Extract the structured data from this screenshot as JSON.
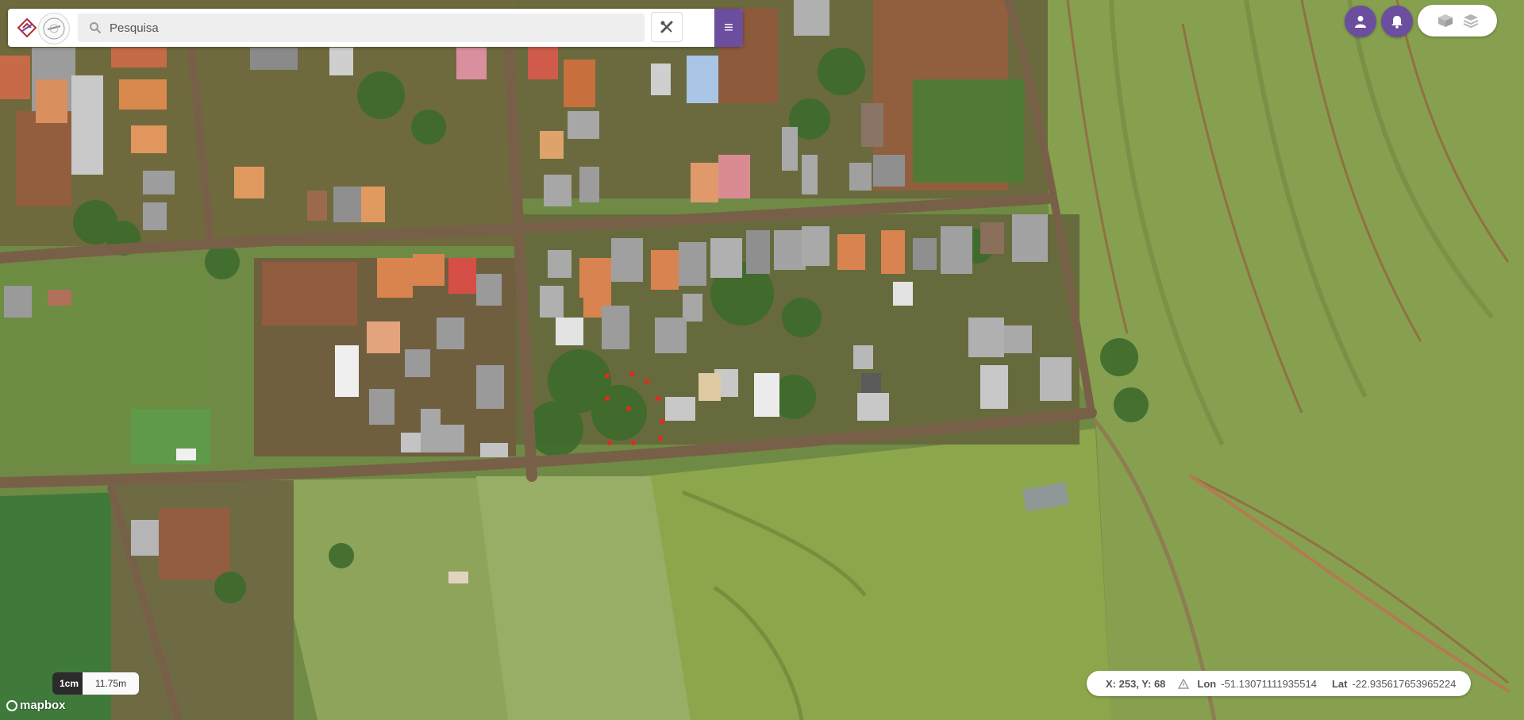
{
  "search": {
    "placeholder": "Pesquisa"
  },
  "toolbar": {
    "tools_icon": "wrench-ruler-icon",
    "menu_icon": "hamburger-menu-icon"
  },
  "top_right": {
    "user_icon": "user-icon",
    "notifications_icon": "bell-icon",
    "layer_icons": [
      "layers-3d-icon",
      "layers-stack-icon"
    ]
  },
  "scale": {
    "unit_label": "1cm",
    "distance_label": "11.75m"
  },
  "attribution": {
    "logo_text": "mapbox"
  },
  "cursor_readout": {
    "xy_text": "X: 253, Y: 68",
    "lon_label": "Lon",
    "lon_value": "-51.13071111935514",
    "lat_label": "Lat",
    "lat_value": "-22.935617653965224"
  },
  "colors": {
    "accent": "#6b4e9e",
    "field_green": "#7f9a4f",
    "grass_green": "#86a64d",
    "dirt_road": "#7a6048",
    "red_marker": "#e8271c"
  }
}
